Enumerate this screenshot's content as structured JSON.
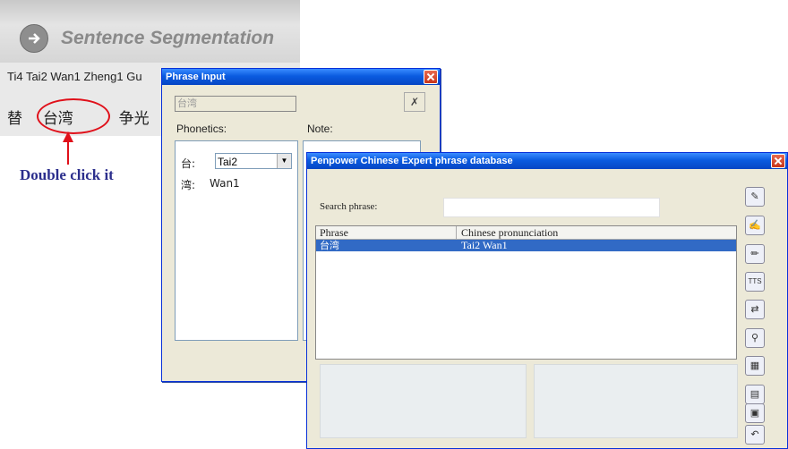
{
  "background_app": {
    "title": "Sentence Segmentation",
    "pinyin_line": "Ti4   Tai2 Wan1   Zheng1 Gu",
    "hanzi_line_1": "替",
    "hanzi_line_2": "台湾",
    "hanzi_line_3": "争光",
    "hint": "Double click it"
  },
  "phrase_input": {
    "title": "Phrase Input",
    "phrase_field": "台湾",
    "phonetics_label": "Phonetics:",
    "note_label": "Note:",
    "rows": [
      {
        "char": "台:",
        "value": "Tai2"
      },
      {
        "char": "湾:",
        "value": "Wan1"
      }
    ]
  },
  "database": {
    "title": "Penpower Chinese Expert phrase database",
    "search_label": "Search phrase:",
    "search_value": "",
    "columns": [
      "Phrase",
      "Chinese pronunciation"
    ],
    "selected_row": {
      "phrase": "台湾",
      "pronunciation": "Tai2 Wan1"
    },
    "tools": [
      "edit-question-icon",
      "notepad-pen-icon",
      "pencil-icon",
      "tts-icon",
      "convert-icon",
      "microphone-icon",
      "grid-icon",
      "page-icon",
      "image-icon",
      "undo-icon"
    ]
  },
  "colors": {
    "annotation": "#e0101a",
    "hint_text": "#2b2e8c",
    "selection": "#316ac5"
  }
}
